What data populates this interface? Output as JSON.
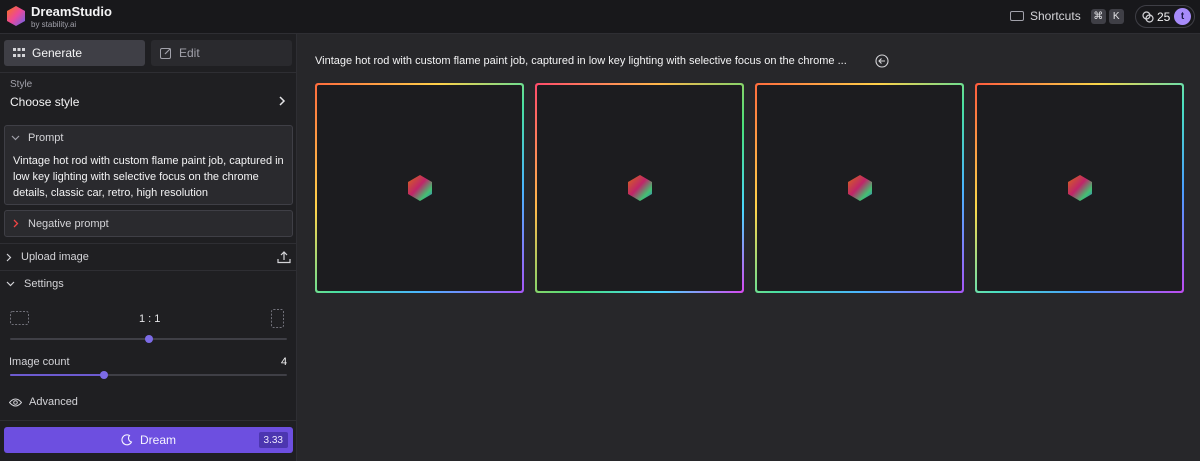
{
  "app": {
    "name": "DreamStudio",
    "by": "by stability.ai"
  },
  "topbar": {
    "shortcuts_label": "Shortcuts",
    "keys": [
      "⌘",
      "K"
    ],
    "credits": "25",
    "avatar_letter": "t"
  },
  "tabs": {
    "generate": "Generate",
    "edit": "Edit"
  },
  "style": {
    "label": "Style",
    "value": "Choose style"
  },
  "prompt": {
    "header": "Prompt",
    "text": "Vintage hot rod with custom flame paint job, captured in low key lighting with selective focus on the chrome details, classic car, retro, high resolution"
  },
  "negative_prompt": {
    "header": "Negative prompt"
  },
  "upload": {
    "label": "Upload image"
  },
  "settings": {
    "label": "Settings",
    "aspect_ratio": "1 : 1",
    "aspect_ratio_slider": 0.5,
    "image_count_label": "Image count",
    "image_count": "4",
    "image_count_slider": 0.34,
    "advanced_label": "Advanced"
  },
  "dream": {
    "label": "Dream",
    "cost": "3.33"
  },
  "main": {
    "prompt_title": "Vintage hot rod with custom flame paint job, captured in low key lighting with selective focus on the chrome ...",
    "cards": 4
  },
  "colors": {
    "accent": "#6d4fe0",
    "background": "#27272a",
    "sidebar": "#1f1f22"
  },
  "icons": [
    "logo-icon",
    "keyboard-icon",
    "credits-icon",
    "grid-icon",
    "edit-icon",
    "chevron-right-icon",
    "chevron-down-icon",
    "upload-icon",
    "landscape-icon",
    "portrait-icon",
    "eye-icon",
    "moon-icon",
    "back-arrow-icon",
    "loading-hexagon-icon"
  ]
}
